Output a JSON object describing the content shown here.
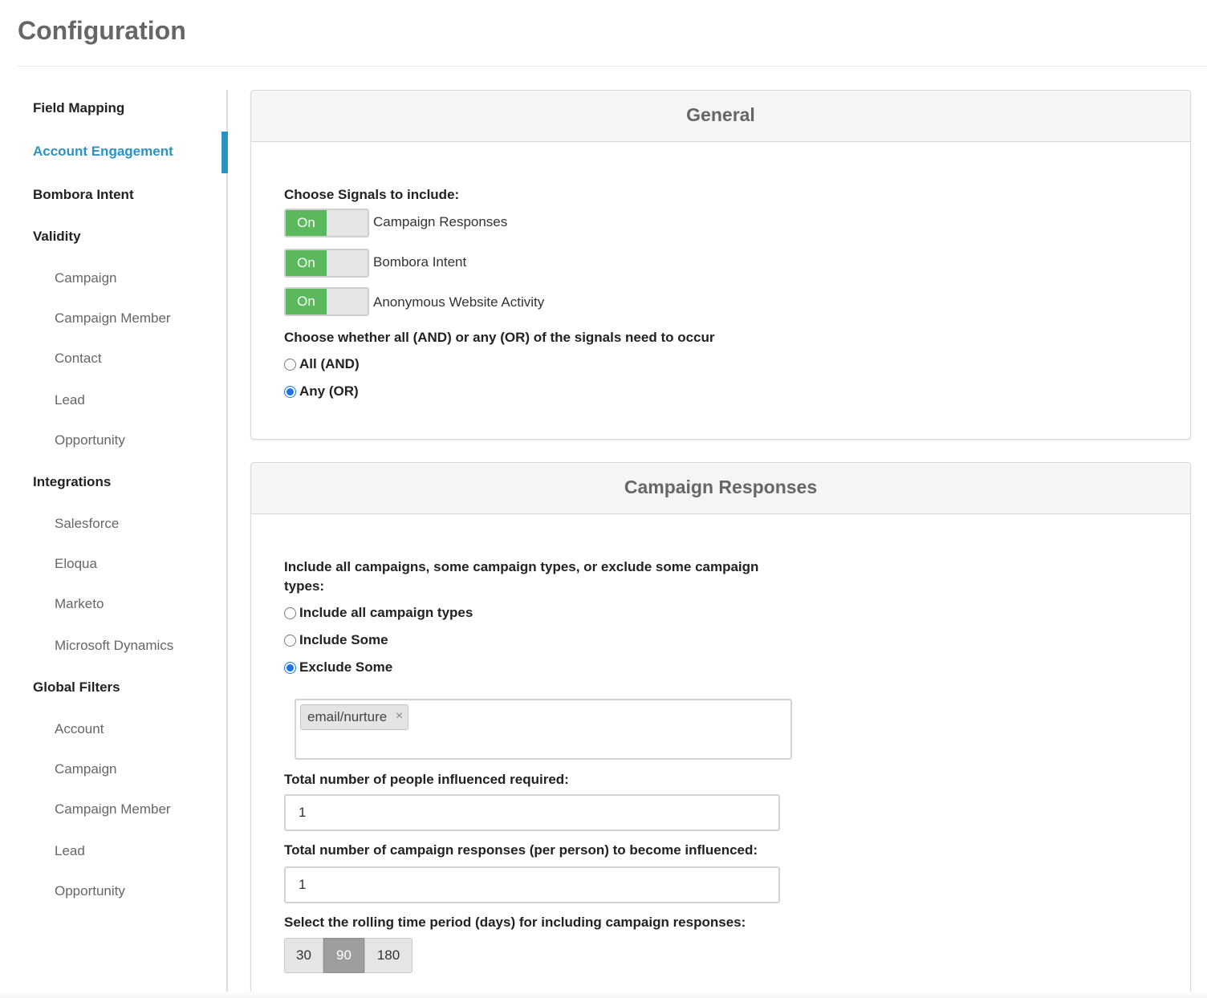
{
  "page": {
    "title": "Configuration"
  },
  "sidebar": {
    "field_mapping": "Field Mapping",
    "account_engagement": "Account Engagement",
    "bombora_intent": "Bombora Intent",
    "validity": {
      "label": "Validity",
      "items": [
        "Campaign",
        "Campaign Member",
        "Contact",
        "Lead",
        "Opportunity"
      ]
    },
    "integrations": {
      "label": "Integrations",
      "items": [
        "Salesforce",
        "Eloqua",
        "Marketo",
        "Microsoft Dynamics"
      ]
    },
    "global_filters": {
      "label": "Global Filters",
      "items": [
        "Account",
        "Campaign",
        "Campaign Member",
        "Lead",
        "Opportunity"
      ]
    },
    "active_item": "Account Engagement",
    "accent_color": "#2a93c4"
  },
  "general": {
    "title": "General",
    "signals_label": "Choose Signals to include:",
    "signals": [
      {
        "label": "Campaign Responses",
        "state": "On"
      },
      {
        "label": "Bombora Intent",
        "state": "On"
      },
      {
        "label": "Anonymous Website Activity",
        "state": "On"
      }
    ],
    "logic_label": "Choose whether all (AND) or any (OR) of the signals need to occur",
    "logic_options": [
      {
        "label": "All (AND)",
        "checked": false
      },
      {
        "label": "Any (OR)",
        "checked": true
      }
    ]
  },
  "campaign_responses": {
    "title": "Campaign Responses",
    "include_label": "Include all campaigns, some campaign types, or exclude some campaign types:",
    "include_options": [
      {
        "label": "Include all campaign types",
        "checked": false
      },
      {
        "label": "Include Some",
        "checked": false
      },
      {
        "label": "Exclude Some",
        "checked": true
      }
    ],
    "excluded_tags": [
      "email/nurture"
    ],
    "tag_remove_glyph": "×",
    "people_label": "Total number of people influenced required:",
    "people_value": "1",
    "responses_label": "Total number of campaign responses (per person) to become influenced:",
    "responses_value": "1",
    "period_label": "Select the rolling time period (days) for including campaign responses:",
    "period_options": [
      "30",
      "90",
      "180"
    ],
    "period_selected": "90"
  }
}
